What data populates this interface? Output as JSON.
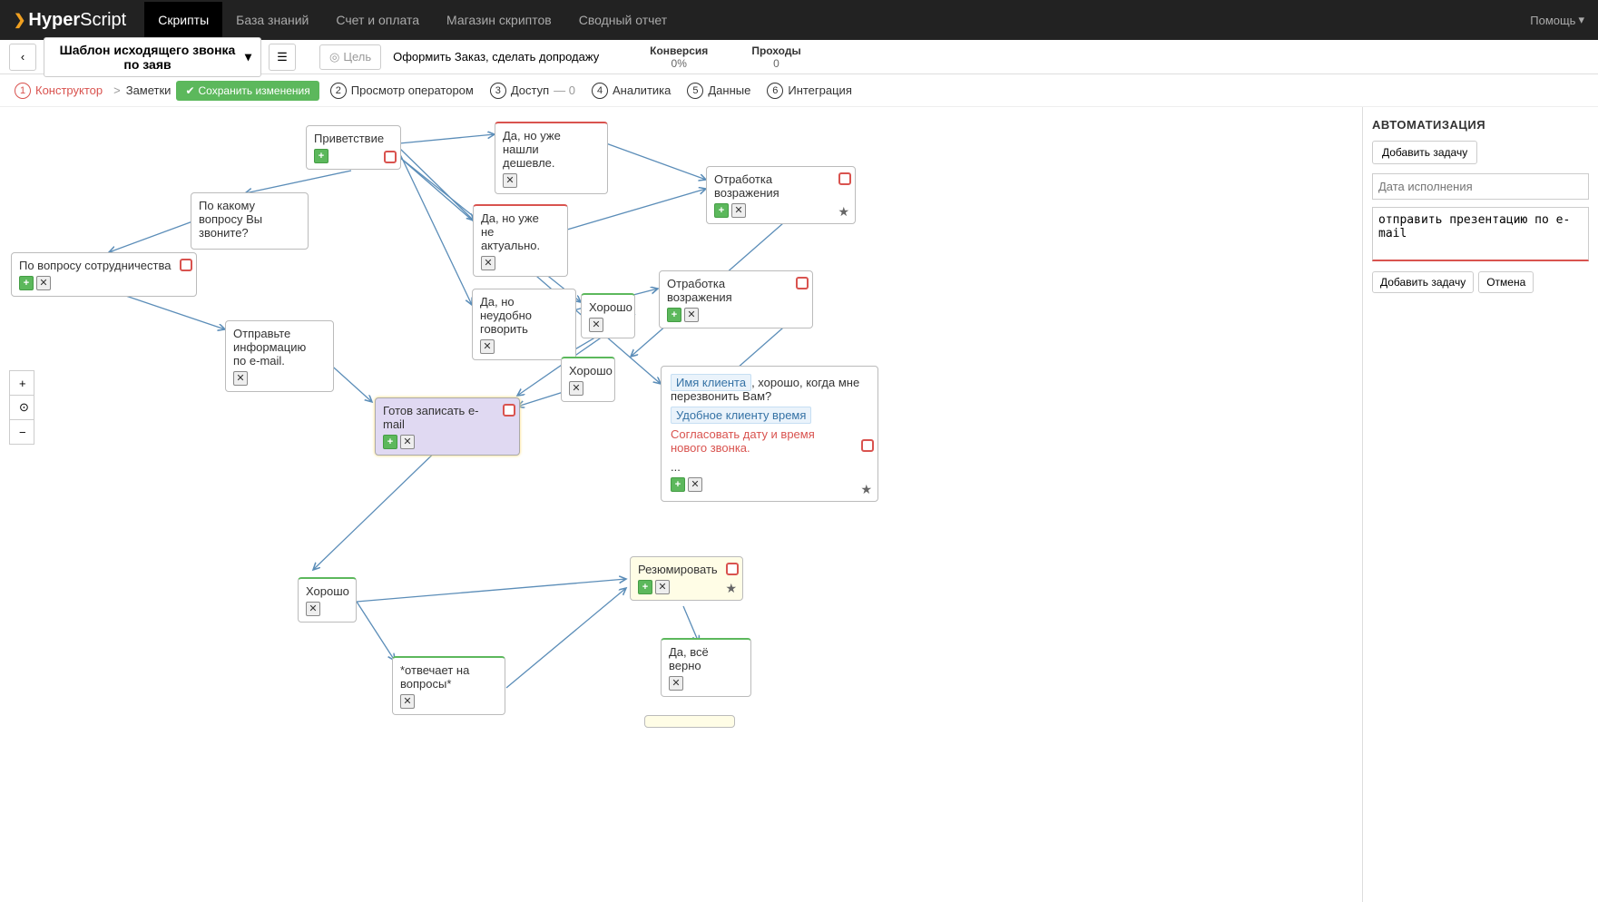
{
  "logo": {
    "prefix": "Hyper",
    "suffix": "Script"
  },
  "topnav": [
    "Скрипты",
    "База знаний",
    "Счет и оплата",
    "Магазин скриптов",
    "Сводный отчет"
  ],
  "help": "Помощь",
  "toolbar": {
    "script_title": "Шаблон исходящего звонка по заяв",
    "goal_label": "Цель",
    "goal_value": "Оформить Заказ, сделать допродажу",
    "metrics": [
      {
        "label": "Конверсия",
        "value": "0%"
      },
      {
        "label": "Проходы",
        "value": "0"
      }
    ]
  },
  "steps": {
    "constructor": "Конструктор",
    "notes": "Заметки",
    "save": "Сохранить изменения",
    "list": [
      "Просмотр оператором",
      "Доступ",
      "Аналитика",
      "Данные",
      "Интеграция"
    ],
    "access_count": "— 0"
  },
  "nodes": {
    "greeting": "Приветствие",
    "question": "По какому вопросу Вы звоните?",
    "cooperation": "По вопросу сотрудничества",
    "cheaper": "Да, но уже нашли дешевле.",
    "irrelevant": "Да, но уже не актуально.",
    "inconvenient": "Да, но неудобно говорить",
    "objection": "Отработка возражения",
    "send_email": "Отправьте информацию по e-mail.",
    "ok": "Хорошо",
    "ready_email": "Готов записать e-mail",
    "answers": "*отвечает на вопросы*",
    "resume": "Резюмировать",
    "yes_correct": "Да, всё верно",
    "big": {
      "tag1": "Имя клиента",
      "text1": ", хорошо, когда мне перезвонить Вам?",
      "tag2": "Удобное клиенту время",
      "text2": "Согласовать дату и время нового звонка.",
      "ellipsis": "..."
    }
  },
  "sidebar": {
    "title": "АВТОМАТИЗАЦИЯ",
    "add_task": "Добавить задачу",
    "date_placeholder": "Дата исполнения",
    "task_text": "отправить презентацию по e-mail",
    "cancel": "Отмена"
  }
}
